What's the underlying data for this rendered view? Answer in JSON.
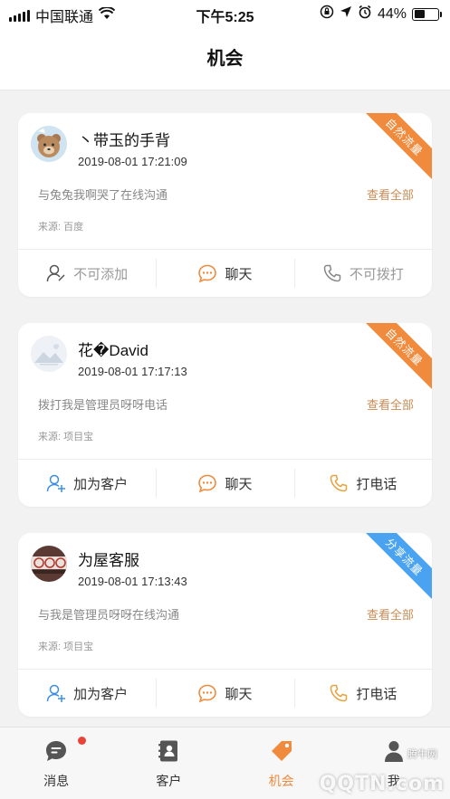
{
  "status_bar": {
    "carrier": "中国联通",
    "time": "下午5:25",
    "battery_percent": "44%",
    "battery_level": 0.44,
    "icons": [
      "signal-icon",
      "wifi-icon",
      "rotation-lock-icon",
      "location-icon",
      "alarm-icon",
      "battery-icon"
    ]
  },
  "nav": {
    "title": "机会"
  },
  "cards": [
    {
      "name": "丶带玉的手背",
      "time": "2019-08-01 17:21:09",
      "message": "与兔兔我啊哭了在线沟通",
      "view_all": "查看全部",
      "source": "来源: 百度",
      "ribbon": {
        "text": "自然流量",
        "color": "#f08a3c"
      },
      "actions": [
        {
          "label": "不可添加",
          "icon": "user-disabled-icon",
          "color": "#999999",
          "disabled": true
        },
        {
          "label": "聊天",
          "icon": "chat-icon",
          "color": "#f08a3c",
          "disabled": false
        },
        {
          "label": "不可拨打",
          "icon": "phone-disabled-icon",
          "color": "#999999",
          "disabled": true
        }
      ]
    },
    {
      "name": "花�David",
      "time": "2019-08-01 17:17:13",
      "message": "拨打我是管理员呀呀电话",
      "view_all": "查看全部",
      "source": "来源: 项目宝",
      "ribbon": {
        "text": "自然流量",
        "color": "#f08a3c"
      },
      "actions": [
        {
          "label": "加为客户",
          "icon": "add-user-icon",
          "color": "#3a8ee6",
          "disabled": false
        },
        {
          "label": "聊天",
          "icon": "chat-icon",
          "color": "#f08a3c",
          "disabled": false
        },
        {
          "label": "打电话",
          "icon": "phone-icon",
          "color": "#e6a23c",
          "disabled": false
        }
      ]
    },
    {
      "name": "为屋客服",
      "time": "2019-08-01 17:13:43",
      "message": "与我是管理员呀呀在线沟通",
      "view_all": "查看全部",
      "source": "来源: 项目宝",
      "ribbon": {
        "text": "分享流量",
        "color": "#4aa3f0"
      },
      "actions": [
        {
          "label": "加为客户",
          "icon": "add-user-icon",
          "color": "#3a8ee6",
          "disabled": false
        },
        {
          "label": "聊天",
          "icon": "chat-icon",
          "color": "#f08a3c",
          "disabled": false
        },
        {
          "label": "打电话",
          "icon": "phone-icon",
          "color": "#e6a23c",
          "disabled": false
        }
      ]
    }
  ],
  "tabs": [
    {
      "label": "消息",
      "icon": "message-icon",
      "badge": true
    },
    {
      "label": "客户",
      "icon": "contacts-icon",
      "badge": false
    },
    {
      "label": "机会",
      "icon": "tag-icon",
      "active": true
    },
    {
      "label": "我",
      "icon": "person-icon",
      "badge": false
    }
  ],
  "watermark": {
    "text": "QQTN.com",
    "site": "腾牛网"
  }
}
